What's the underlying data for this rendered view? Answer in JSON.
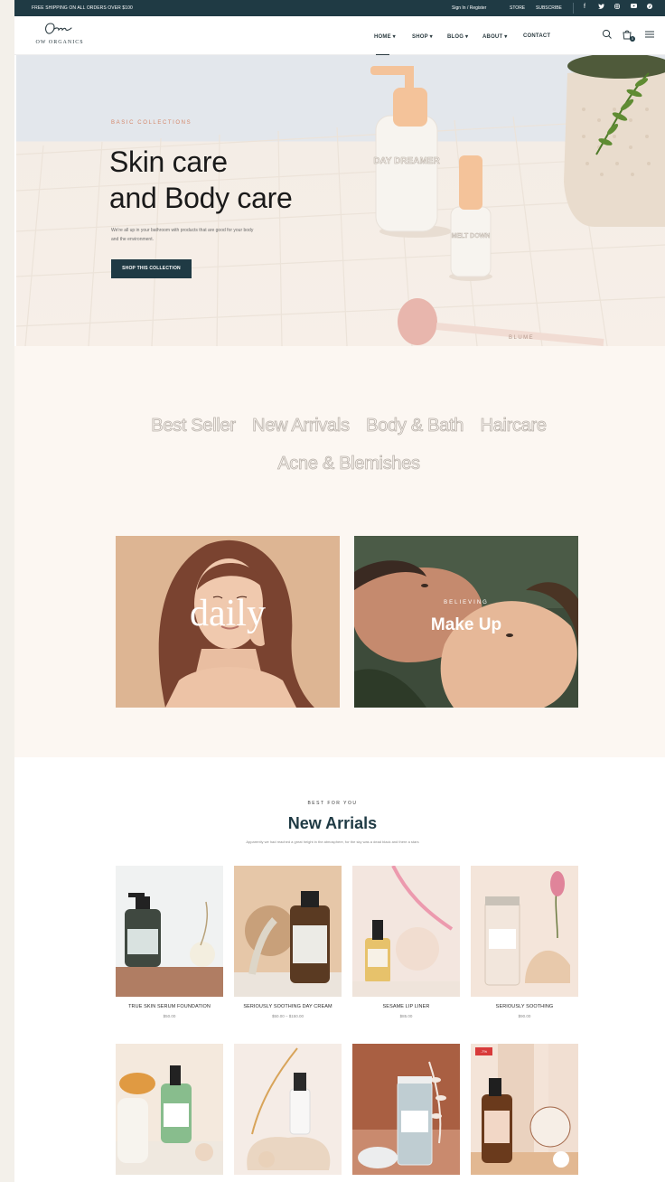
{
  "topbar": {
    "shipping": "FREE SHIPPING ON ALL ORDERS OVER $100",
    "signin": "Sign In / Register",
    "store": "STORE",
    "subscribe": "SUBSCRIBE"
  },
  "header": {
    "brand": "OW ORGANICS",
    "nav": [
      "HOME",
      "SHOP",
      "BLOG",
      "ABOUT",
      "CONTACT"
    ],
    "cart_count": "0"
  },
  "hero": {
    "eyebrow": "BASIC COLLECTIONS",
    "title_line1": "Skin care",
    "title_line2": "and Body care",
    "desc_line1": "We're all up in your bathroom with products that are good for your body",
    "desc_line2": "and the environment.",
    "button": "SHOP THIS COLLECTION",
    "label_day": "DAY DREAMER",
    "label_melt": "MELT DOWN",
    "label_roller": "BLUME",
    "colors": {
      "dark": "#1f3a44",
      "accent": "#d4876a"
    }
  },
  "categories": {
    "items": [
      "Best Seller",
      "New Arrivals",
      "Body & Bath",
      "Haircare",
      "Acne & Blemishes"
    ]
  },
  "banners": {
    "daily": "daily",
    "makeup_eyebrow": "BELIEVING",
    "makeup_title": "Make Up"
  },
  "new_arrivals": {
    "eyebrow": "BEST FOR YOU",
    "title": "New Arrials",
    "subtitle": "Apparently we had reached a great height in the atmosphere, for the sky was a dead black and there a stars",
    "products": [
      {
        "name": "TRUE SKIN SERUM FOUNDATION",
        "price": "$50.00"
      },
      {
        "name": "SERIOUSLY SOOTHING DAY CREAM",
        "price": "$50.00 – $150.00"
      },
      {
        "name": "SESAME LIP LINER",
        "price": "$85.00"
      },
      {
        "name": "SERIOUSLY SOOTHING",
        "price": "$90.00"
      }
    ],
    "sale_label": "-7%"
  }
}
